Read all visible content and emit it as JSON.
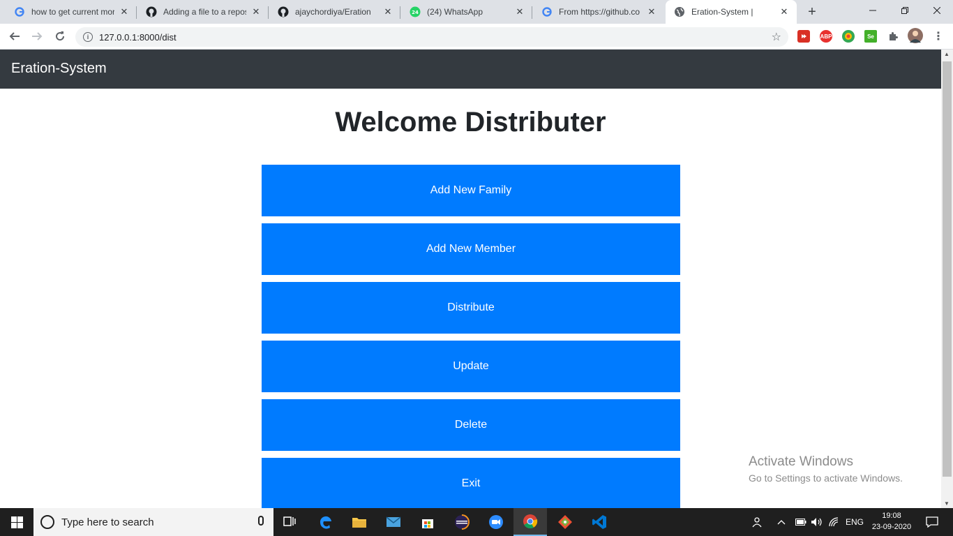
{
  "browser": {
    "tabs": [
      {
        "title": "how to get current mor",
        "icon": "google-icon"
      },
      {
        "title": "Adding a file to a repos",
        "icon": "github-icon"
      },
      {
        "title": "ajaychordiya/Eration",
        "icon": "github-icon"
      },
      {
        "title": "(24) WhatsApp",
        "icon": "whatsapp-icon",
        "badge": "24"
      },
      {
        "title": "From https://github.co",
        "icon": "google-icon"
      },
      {
        "title": "Eration-System |",
        "icon": "globe-icon",
        "active": true
      }
    ],
    "url": "127.0.0.1:8000/dist",
    "extensions": [
      {
        "name": "ext-red-icon",
        "color": "#d93025",
        "label": ""
      },
      {
        "name": "adblock-plus-icon",
        "color": "#e8312f",
        "label": "ABP"
      },
      {
        "name": "ext-globe-icon",
        "color": "#34a853",
        "label": ""
      },
      {
        "name": "selenium-icon",
        "color": "#43b02a",
        "label": "Se"
      }
    ]
  },
  "app": {
    "brand": "Eration-System",
    "title": "Welcome Distributer",
    "buttons": [
      "Add New Family",
      "Add New Member",
      "Distribute",
      "Update",
      "Delete",
      "Exit"
    ]
  },
  "watermark": {
    "line1": "Activate Windows",
    "line2": "Go to Settings to activate Windows."
  },
  "taskbar": {
    "search_placeholder": "Type here to search",
    "language": "ENG",
    "time": "19:08",
    "date": "23-09-2020"
  },
  "colors": {
    "navbar": "#343a40",
    "button": "#007bff",
    "taskbar": "#1f1f1f"
  }
}
